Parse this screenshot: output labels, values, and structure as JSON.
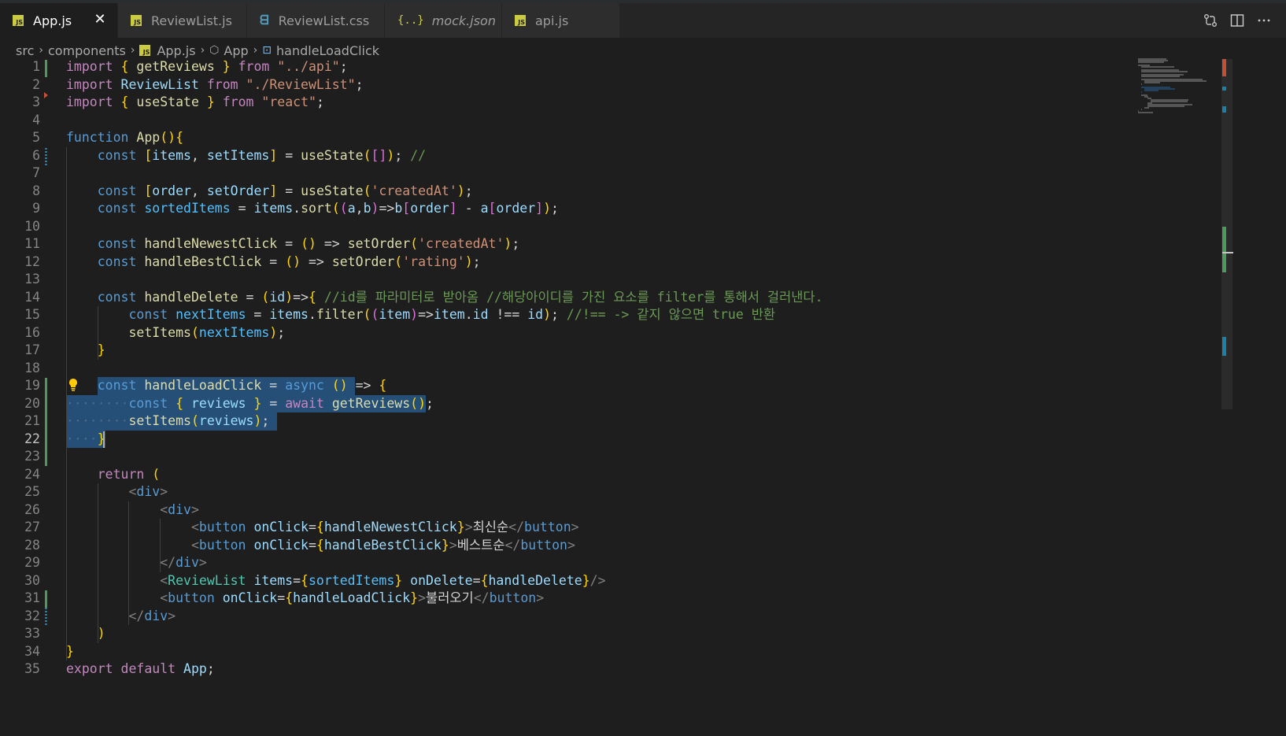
{
  "tabs": [
    {
      "label": "App.js",
      "icon": "js-icon",
      "active": true
    },
    {
      "label": "ReviewList.js",
      "icon": "js-icon",
      "active": false
    },
    {
      "label": "ReviewList.css",
      "icon": "css-icon",
      "active": false
    },
    {
      "label": "mock.json",
      "icon": "json-icon",
      "active": false
    },
    {
      "label": "api.js",
      "icon": "js-icon",
      "active": false
    }
  ],
  "tab_close": "✕",
  "toolbar_icons": [
    "compare-changes-icon",
    "split-editor-icon",
    "more-actions-icon"
  ],
  "breadcrumb": {
    "items": [
      "src",
      "components",
      "App.js",
      "App",
      "handleLoadClick"
    ]
  },
  "editor": {
    "current_line": 22,
    "line_numbers": [
      "1",
      "2",
      "3",
      "4",
      "5",
      "6",
      "7",
      "8",
      "9",
      "10",
      "11",
      "12",
      "13",
      "14",
      "15",
      "16",
      "17",
      "18",
      "19",
      "20",
      "21",
      "22",
      "23",
      "24",
      "25",
      "26",
      "27",
      "28",
      "29",
      "30",
      "31",
      "32",
      "33",
      "34",
      "35"
    ],
    "lines": [
      "import { getReviews } from \"../api\";",
      "import ReviewList from \"./ReviewList\";",
      "import { useState } from \"react\";",
      "",
      "function App(){",
      "    const [items, setItems] = useState([]); //",
      "",
      "    const [order, setOrder] = useState('createdAt');",
      "    const sortedItems = items.sort((a,b)=>b[order] - a[order]);",
      "",
      "    const handleNewestClick = () => setOrder('createdAt');",
      "    const handleBestClick = () => setOrder('rating');",
      "",
      "    const handleDelete = (id)=>{ //id를 파라미터로 받아옴 //해당아이디를 가진 요소를 filter를 통해서 걸러낸다.",
      "        const nextItems = items.filter((item)=>item.id !== id); //!== -> 같지 않으면 true 반환",
      "        setItems(nextItems);",
      "    }",
      "",
      "    const handleLoadClick = async () => {",
      "        const { reviews } = await getReviews();",
      "        setItems(reviews);",
      "    }",
      "",
      "    return (",
      "        <div>",
      "            <div>",
      "                <button onClick={handleNewestClick}>최신순</button>",
      "                <button onClick={handleBestClick}>베스트순</button>",
      "            </div>",
      "            <ReviewList items={sortedItems} onDelete={handleDelete}/>",
      "            <button onClick={handleLoadClick}>불러오기</button>",
      "        </div>",
      "    )",
      "}",
      "export default App;"
    ]
  },
  "colors": {
    "background": "#1e1e1e",
    "keyword": "#569cd6",
    "control_keyword": "#c586c0",
    "function": "#dcdcaa",
    "variable": "#9cdcfe",
    "string": "#ce9178",
    "comment": "#6a9955",
    "component": "#4ec9b0",
    "selection": "#264f78"
  }
}
